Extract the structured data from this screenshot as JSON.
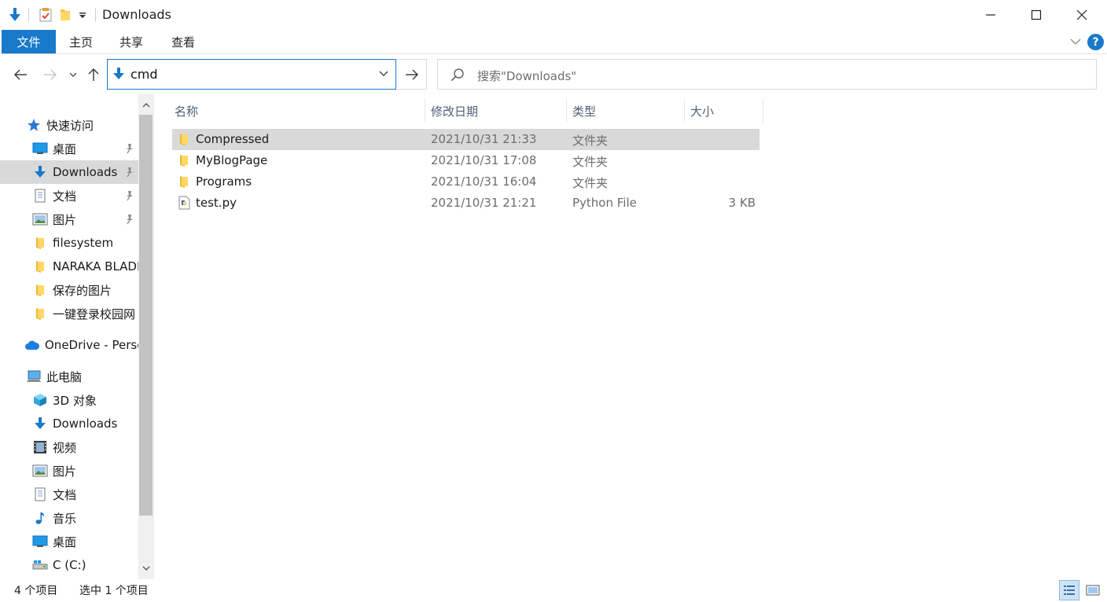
{
  "window": {
    "title": "Downloads",
    "minimize_icon": "minimize-icon",
    "maximize_icon": "maximize-icon",
    "close_icon": "close-icon"
  },
  "ribbon": {
    "tabs": [
      {
        "label": "文件",
        "active": true
      },
      {
        "label": "主页"
      },
      {
        "label": "共享"
      },
      {
        "label": "查看"
      }
    ],
    "help": "?"
  },
  "nav": {
    "address_value": "cmd",
    "search_placeholder": "搜索\"Downloads\""
  },
  "sidebar": {
    "quick_access": {
      "label": "快速访问",
      "items": [
        {
          "label": "桌面",
          "icon": "desktop-icon",
          "pinned": true
        },
        {
          "label": "Downloads",
          "icon": "download-arrow-icon",
          "pinned": true,
          "selected": true
        },
        {
          "label": "文档",
          "icon": "document-icon",
          "pinned": true
        },
        {
          "label": "图片",
          "icon": "picture-icon",
          "pinned": true
        },
        {
          "label": "filesystem",
          "icon": "folder-icon"
        },
        {
          "label": "NARAKA  BLADEPOINT",
          "icon": "folder-icon"
        },
        {
          "label": "保存的图片",
          "icon": "folder-icon"
        },
        {
          "label": "一键登录校园网",
          "icon": "folder-icon"
        }
      ]
    },
    "onedrive": {
      "label": "OneDrive - Personal"
    },
    "this_pc": {
      "label": "此电脑",
      "items": [
        {
          "label": "3D 对象",
          "icon": "3d-objects-icon"
        },
        {
          "label": "Downloads",
          "icon": "download-arrow-icon"
        },
        {
          "label": "视频",
          "icon": "video-icon"
        },
        {
          "label": "图片",
          "icon": "picture-icon"
        },
        {
          "label": "文档",
          "icon": "document-icon"
        },
        {
          "label": "音乐",
          "icon": "music-icon"
        },
        {
          "label": "桌面",
          "icon": "desktop-icon"
        },
        {
          "label": "C (C:)",
          "icon": "drive-icon"
        }
      ]
    }
  },
  "content": {
    "columns": {
      "name": "名称",
      "date": "修改日期",
      "type": "类型",
      "size": "大小"
    },
    "files": [
      {
        "name": "Compressed",
        "date": "2021/10/31 21:33",
        "type": "文件夹",
        "size": "",
        "icon": "folder-icon",
        "selected": true
      },
      {
        "name": "MyBlogPage",
        "date": "2021/10/31 17:08",
        "type": "文件夹",
        "size": "",
        "icon": "folder-icon"
      },
      {
        "name": "Programs",
        "date": "2021/10/31 16:04",
        "type": "文件夹",
        "size": "",
        "icon": "folder-icon"
      },
      {
        "name": "test.py",
        "date": "2021/10/31 21:21",
        "type": "Python File",
        "size": "3 KB",
        "icon": "python-file-icon"
      }
    ]
  },
  "status": {
    "count": "4 个项目",
    "selection": "选中 1 个项目"
  },
  "colors": {
    "accent": "#1979ca",
    "selection": "#d9d9d9",
    "folder": "#f7c948"
  }
}
